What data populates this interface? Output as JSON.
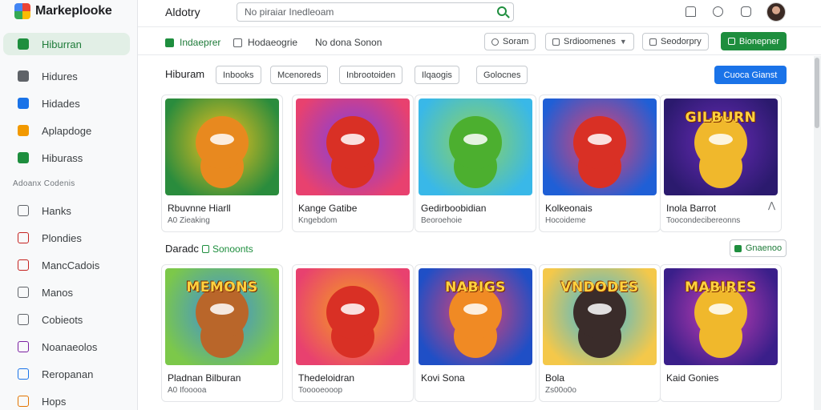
{
  "sidebar": {
    "brand": "Markeplooke",
    "items": [
      {
        "label": "Hiburran",
        "color": "#1e8e3e"
      },
      {
        "label": "Hidures",
        "color": "#5f6368"
      },
      {
        "label": "Hidades",
        "color": "#1a73e8"
      },
      {
        "label": "Aplapdoge",
        "color": "#f29900"
      },
      {
        "label": "Hiburass",
        "color": "#1e8e3e"
      }
    ],
    "section_label": "Adoanx Codenis",
    "items2": [
      {
        "label": "Hanks",
        "color": "#5f6368"
      },
      {
        "label": "Plondies",
        "color": "#c5221f"
      },
      {
        "label": "MancCadois",
        "color": "#c5221f"
      },
      {
        "label": "Manos",
        "color": "#5f6368"
      },
      {
        "label": "Cobieots",
        "color": "#5f6368"
      },
      {
        "label": "Noanaeolos",
        "color": "#7b1fa2"
      },
      {
        "label": "Reropanan",
        "color": "#1a73e8"
      },
      {
        "label": "Hops",
        "color": "#e37400"
      }
    ]
  },
  "topbar": {
    "title": "Aldotry",
    "search_placeholder": "No piraiar Inedleoam",
    "icons": [
      "home-icon",
      "apps-icon",
      "chat-icon"
    ]
  },
  "filterbar": {
    "check1": "Indaeprer",
    "check2": "Hodaeogrie",
    "text3": "No dona Sonon",
    "btn1": "Soram",
    "btn2": "Srdioomenes",
    "btn3": "Seodorpry",
    "primary": "Bionepner"
  },
  "section1": {
    "title": "Hiburam",
    "chips": [
      "Inbooks",
      "Mcenoreds",
      "Inbrootoiden",
      "Ilqaogis",
      "Golocnes"
    ],
    "button": "Cuoca Gianst",
    "cards": [
      {
        "title": "Rbuvnne Hiarll",
        "sub": "A0 Zieaking",
        "thumb": "bear-mascot",
        "bg1": "#2a8c3d",
        "bg2": "#f6c21c",
        "body": "#e8891f"
      },
      {
        "title": "Kange Gatibe",
        "sub": "Kngebdom",
        "thumb": "kid-cap-mascot",
        "bg1": "#e8416f",
        "bg2": "#7b3fe4",
        "body": "#d93025"
      },
      {
        "title": "Gedirboobidian",
        "sub": "Beoroehoie",
        "thumb": "green-bear-mascot",
        "bg1": "#39b8e8",
        "bg2": "#8fd45a",
        "body": "#4caf2f"
      },
      {
        "title": "Kolkeonais",
        "sub": "Hocoideme",
        "thumb": "kid-mascot",
        "bg1": "#1f5fd6",
        "bg2": "#e8416f",
        "body": "#d93025"
      },
      {
        "title": "Inola Barrot",
        "sub": "Toocondecibereonns",
        "thumb": "gilburn-title",
        "bg1": "#2b1a6e",
        "bg2": "#6a2bb8",
        "body": "#f0b82c",
        "text": "GILBURN"
      }
    ]
  },
  "section2": {
    "title": "Daradc",
    "link": "Sonoonts",
    "button": "Gnaenoo",
    "cards": [
      {
        "title": "Pladnan Bilburan",
        "sub": "A0 Ifooooa",
        "thumb": "memons-title",
        "bg1": "#7cc84a",
        "bg2": "#3c8dde",
        "body": "#b9662a",
        "text": "MEMONS"
      },
      {
        "title": "Thedeloidran",
        "sub": "Tooooeooop",
        "thumb": "kid-crown-mascot",
        "bg1": "#e8416f",
        "bg2": "#f6a21c",
        "body": "#d93025"
      },
      {
        "title": "Kovi Sona",
        "sub": "",
        "thumb": "nabigs-title",
        "bg1": "#1f4fc6",
        "bg2": "#e8416f",
        "body": "#f08a24",
        "text": "NABIGS"
      },
      {
        "title": "Bola",
        "sub": "Zs00o0o",
        "thumb": "vndodes-title",
        "bg1": "#f4c84a",
        "bg2": "#38b7e0",
        "body": "#3a2c2a",
        "text": "VNDODES"
      },
      {
        "title": "Kaid Gonies",
        "sub": "",
        "thumb": "mabires-title",
        "bg1": "#3a1f8a",
        "bg2": "#c73fb5",
        "body": "#f0b82c",
        "text": "MABIRES"
      }
    ]
  }
}
